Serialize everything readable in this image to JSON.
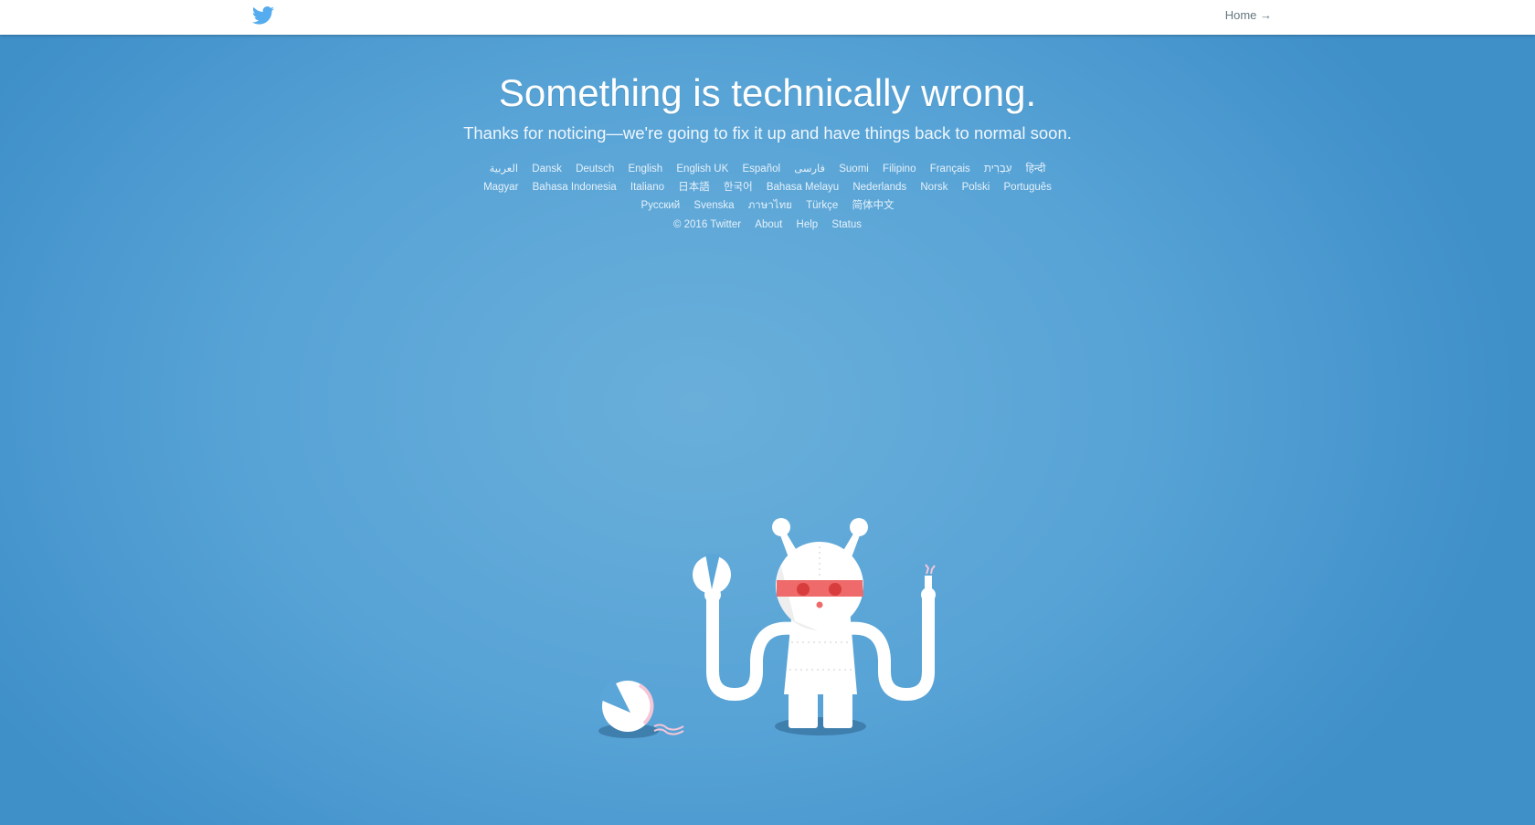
{
  "header": {
    "logo": "twitter-bird-icon",
    "home_link": "Home →"
  },
  "main": {
    "title": "Something is technically wrong.",
    "subtitle": "Thanks for noticing—we're going to fix it up and have things back to normal soon."
  },
  "languages": [
    "العربية",
    "Dansk",
    "Deutsch",
    "English",
    "English UK",
    "Español",
    "فارسی",
    "Suomi",
    "Filipino",
    "Français",
    "עִבְרִית",
    "हिन्दी",
    "Magyar",
    "Bahasa Indonesia",
    "Italiano",
    "日本語",
    "한국어",
    "Bahasa Melayu",
    "Nederlands",
    "Norsk",
    "Polski",
    "Português",
    "Русский",
    "Svenska",
    "ภาษาไทย",
    "Türkçe",
    "简体中文"
  ],
  "footer": {
    "copyright": "© 2016 Twitter",
    "about": "About",
    "help": "Help",
    "status": "Status"
  },
  "colors": {
    "brand": "#55acee",
    "background": "#5aa6d8",
    "band": "#ef6a6a"
  }
}
